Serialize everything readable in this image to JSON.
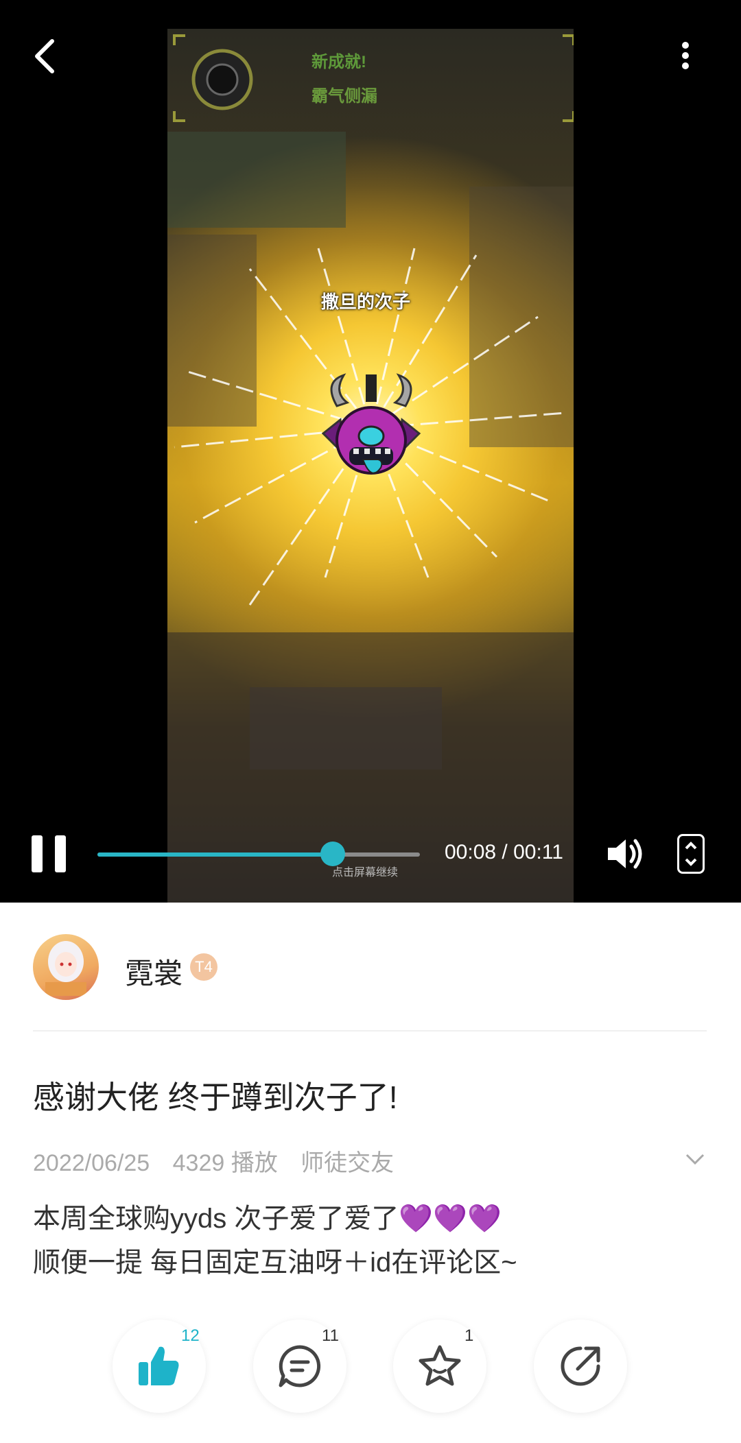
{
  "video": {
    "achievement_title": "新成就!",
    "achievement_name": "霸气侧漏",
    "item_name": "撒旦的次子",
    "tap_hint": "点击屏幕继续",
    "time_display": "00:08 / 00:11",
    "progress": 0.73
  },
  "user": {
    "name": "霓裳",
    "level_badge": "T4"
  },
  "post": {
    "title": "感谢大佬 终于蹲到次子了!",
    "date": "2022/06/25",
    "plays": "4329 播放",
    "tag": "师徒交友",
    "desc_line1": "本周全球购yyds 次子爱了爱了💜💜💜",
    "desc_line2": "顺便一提 每日固定互油呀＋id在评论区~"
  },
  "actions": {
    "likes": "12",
    "comments": "11",
    "favorites": "1"
  },
  "colors": {
    "accent": "#29b6c6",
    "like_icon": "#1eb3c9"
  }
}
